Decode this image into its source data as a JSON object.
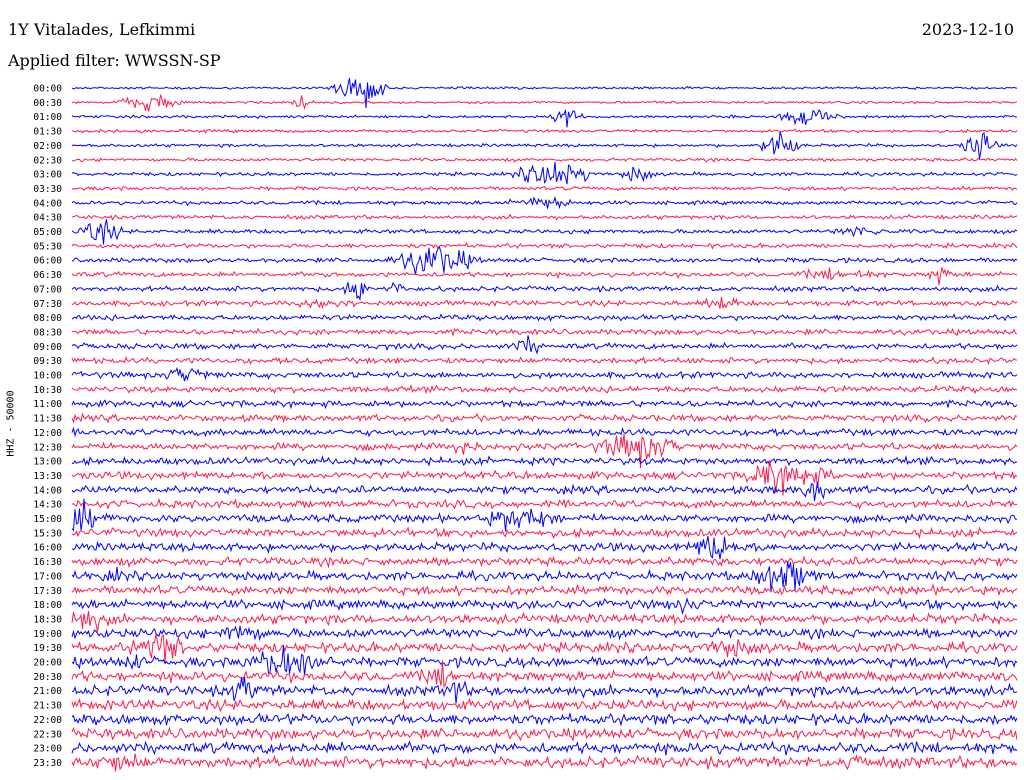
{
  "header": {
    "station": "1Y Vitalades, Lefkimmi",
    "date": "2023-12-10",
    "filter": "Applied filter: WWSSN-SP"
  },
  "chart_data": {
    "type": "line",
    "title": "1Y Vitalades, Lefkimmi",
    "ylabel": "HHZ - 50000",
    "rows": [
      "00:00",
      "00:30",
      "01:00",
      "01:30",
      "02:00",
      "02:30",
      "03:00",
      "03:30",
      "04:00",
      "04:30",
      "05:00",
      "05:30",
      "06:00",
      "06:30",
      "07:00",
      "07:30",
      "08:00",
      "08:30",
      "09:00",
      "09:30",
      "10:00",
      "10:30",
      "11:00",
      "11:30",
      "12:00",
      "12:30",
      "13:00",
      "13:30",
      "14:00",
      "14:30",
      "15:00",
      "15:30",
      "16:00",
      "16:30",
      "17:00",
      "17:30",
      "18:00",
      "18:30",
      "19:00",
      "19:30",
      "20:00",
      "20:30",
      "21:00",
      "21:30",
      "22:00",
      "22:30",
      "23:00",
      "23:30"
    ],
    "series": [
      {
        "color": "#0000ff"
      },
      {
        "color": "#ff1a4d"
      }
    ],
    "grid": false
  }
}
